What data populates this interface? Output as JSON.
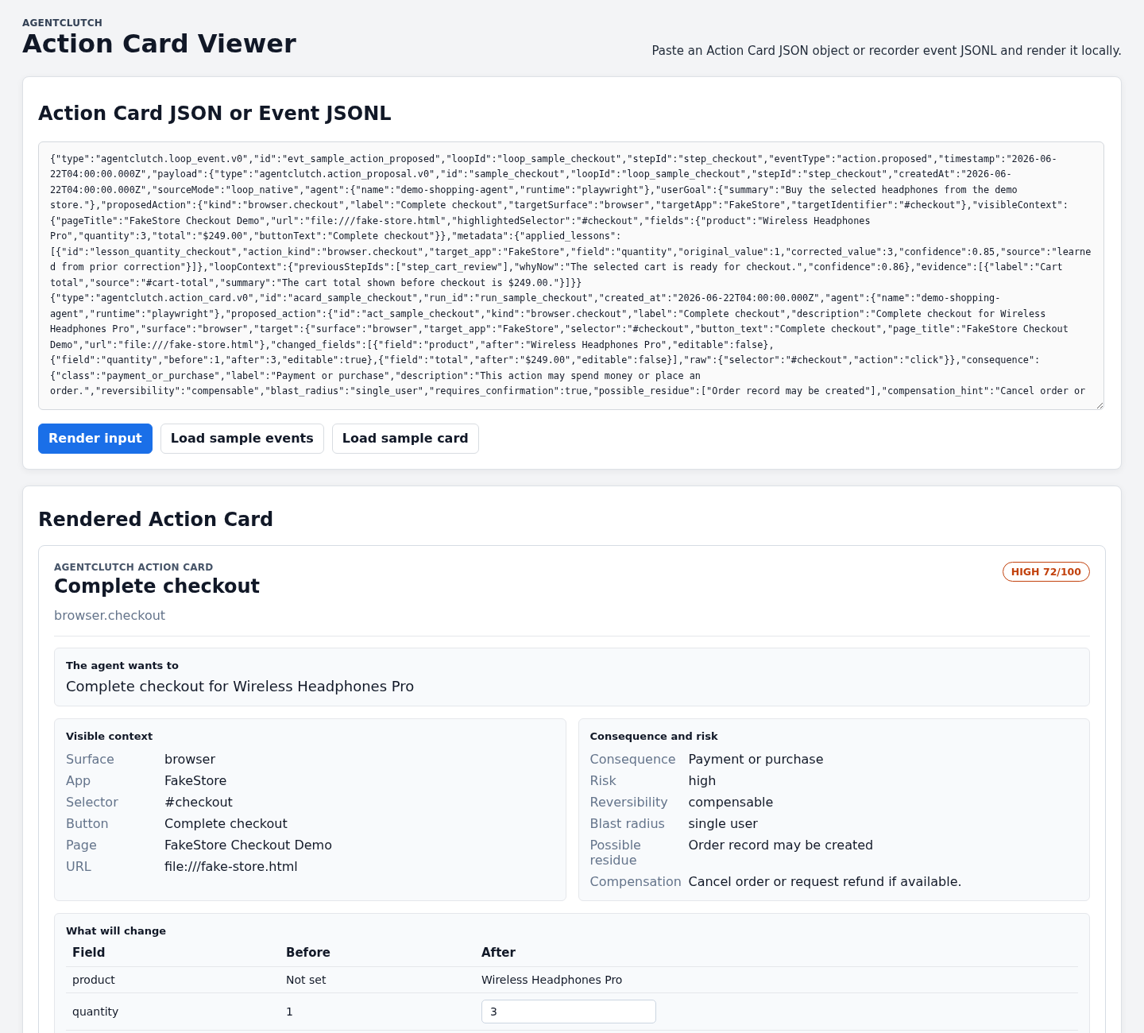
{
  "header": {
    "eyebrow": "AGENTCLUTCH",
    "title": "Action Card Viewer",
    "subtitle": "Paste an Action Card JSON object or recorder event JSONL and render it locally."
  },
  "input_panel": {
    "title": "Action Card JSON or Event JSONL",
    "input": {
      "value": "{\"type\":\"agentclutch.loop_event.v0\",\"id\":\"evt_sample_action_proposed\",\"loopId\":\"loop_sample_checkout\",\"stepId\":\"step_checkout\",\"eventType\":\"action.proposed\",\"timestamp\":\"2026-06-22T04:00:00.000Z\",\"payload\":{\"type\":\"agentclutch.action_proposal.v0\",\"id\":\"sample_checkout\",\"loopId\":\"loop_sample_checkout\",\"stepId\":\"step_checkout\",\"createdAt\":\"2026-06-22T04:00:00.000Z\",\"sourceMode\":\"loop_native\",\"agent\":{\"name\":\"demo-shopping-agent\",\"runtime\":\"playwright\"},\"userGoal\":{\"summary\":\"Buy the selected headphones from the demo store.\"},\"proposedAction\":{\"kind\":\"browser.checkout\",\"label\":\"Complete checkout\",\"targetSurface\":\"browser\",\"targetApp\":\"FakeStore\",\"targetIdentifier\":\"#checkout\"},\"visibleContext\":{\"pageTitle\":\"FakeStore Checkout Demo\",\"url\":\"file:///fake-store.html\",\"highlightedSelector\":\"#checkout\",\"fields\":{\"product\":\"Wireless Headphones Pro\",\"quantity\":3,\"total\":\"$249.00\",\"buttonText\":\"Complete checkout\"}},\"metadata\":{\"applied_lessons\":[{\"id\":\"lesson_quantity_checkout\",\"action_kind\":\"browser.checkout\",\"target_app\":\"FakeStore\",\"field\":\"quantity\",\"original_value\":1,\"corrected_value\":3,\"confidence\":0.85,\"source\":\"learned from prior correction\"}]},\"loopContext\":{\"previousStepIds\":[\"step_cart_review\"],\"whyNow\":\"The selected cart is ready for checkout.\",\"confidence\":0.86},\"evidence\":[{\"label\":\"Cart total\",\"source\":\"#cart-total\",\"summary\":\"The cart total shown before checkout is $249.00.\"}]}}\n{\"type\":\"agentclutch.action_card.v0\",\"id\":\"acard_sample_checkout\",\"run_id\":\"run_sample_checkout\",\"created_at\":\"2026-06-22T04:00:00.000Z\",\"agent\":{\"name\":\"demo-shopping-agent\",\"runtime\":\"playwright\"},\"proposed_action\":{\"id\":\"act_sample_checkout\",\"kind\":\"browser.checkout\",\"label\":\"Complete checkout\",\"description\":\"Complete checkout for Wireless Headphones Pro\",\"surface\":\"browser\",\"target\":{\"surface\":\"browser\",\"target_app\":\"FakeStore\",\"selector\":\"#checkout\",\"button_text\":\"Complete checkout\",\"page_title\":\"FakeStore Checkout Demo\",\"url\":\"file:///fake-store.html\"},\"changed_fields\":[{\"field\":\"product\",\"after\":\"Wireless Headphones Pro\",\"editable\":false},{\"field\":\"quantity\",\"before\":1,\"after\":3,\"editable\":true},{\"field\":\"total\",\"after\":\"$249.00\",\"editable\":false}],\"raw\":{\"selector\":\"#checkout\",\"action\":\"click\"}},\"consequence\":{\"class\":\"payment_or_purchase\",\"label\":\"Payment or purchase\",\"description\":\"This action may spend money or place an order.\",\"reversibility\":\"compensable\",\"blast_radius\":\"single_user\",\"requires_confirmation\":true,\"possible_residue\":[\"Order record may be created\"],\"compensation_hint\":\"Cancel order or"
    },
    "buttons": [
      {
        "label": "Render input",
        "kind": "primary"
      },
      {
        "label": "Load sample events",
        "kind": "secondary"
      },
      {
        "label": "Load sample card",
        "kind": "secondary"
      }
    ]
  },
  "rendered_panel": {
    "title": "Rendered Action Card",
    "card": {
      "eyebrow": "AGENTCLUTCH ACTION CARD",
      "title": "Complete checkout",
      "kind_label": "browser.checkout",
      "risk_badge": {
        "label": "HIGH 72/100"
      },
      "intent": {
        "label": "The agent wants to",
        "text": "Complete checkout for Wireless Headphones Pro"
      },
      "visible_context": {
        "title": "Visible context",
        "rows": [
          {
            "label": "Surface",
            "value": "browser"
          },
          {
            "label": "App",
            "value": "FakeStore"
          },
          {
            "label": "Selector",
            "value": "#checkout"
          },
          {
            "label": "Button",
            "value": "Complete checkout"
          },
          {
            "label": "Page",
            "value": "FakeStore Checkout Demo"
          },
          {
            "label": "URL",
            "value": "file:///fake-store.html"
          }
        ]
      },
      "consequence": {
        "title": "Consequence and risk",
        "rows": [
          {
            "label": "Consequence",
            "value": "Payment or purchase"
          },
          {
            "label": "Risk",
            "value": "high"
          },
          {
            "label": "Reversibility",
            "value": "compensable"
          },
          {
            "label": "Blast radius",
            "value": "single user"
          },
          {
            "label": "Possible residue",
            "value": "Order record may be created"
          },
          {
            "label": "Compensation",
            "value": "Cancel order or request refund if available."
          }
        ]
      },
      "changes": {
        "title": "What will change",
        "columns": [
          "Field",
          "Before",
          "After"
        ],
        "rows": [
          {
            "field": "product",
            "before": "Not set",
            "after": "Wireless Headphones Pro",
            "editable": false
          },
          {
            "field": "quantity",
            "before": "1",
            "after": "3",
            "editable": true
          }
        ]
      }
    }
  }
}
